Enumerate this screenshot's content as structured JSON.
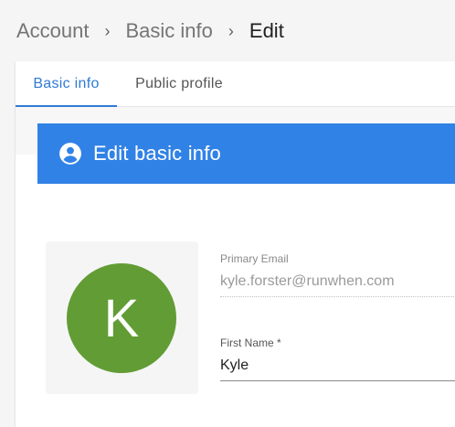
{
  "breadcrumb": {
    "items": [
      "Account",
      "Basic info",
      "Edit"
    ],
    "separator": "›"
  },
  "tabs": [
    {
      "label": "Basic info",
      "active": true
    },
    {
      "label": "Public profile",
      "active": false
    }
  ],
  "header": {
    "title": "Edit basic info",
    "icon": "account-circle-icon",
    "color": "#3182e6"
  },
  "avatar": {
    "initial": "K",
    "color": "#629c35"
  },
  "form": {
    "primary_email": {
      "label": "Primary Email",
      "value": "kyle.forster@runwhen.com"
    },
    "first_name": {
      "label": "First Name *",
      "value": "Kyle"
    }
  },
  "colors": {
    "accent": "#2f7ad7"
  }
}
